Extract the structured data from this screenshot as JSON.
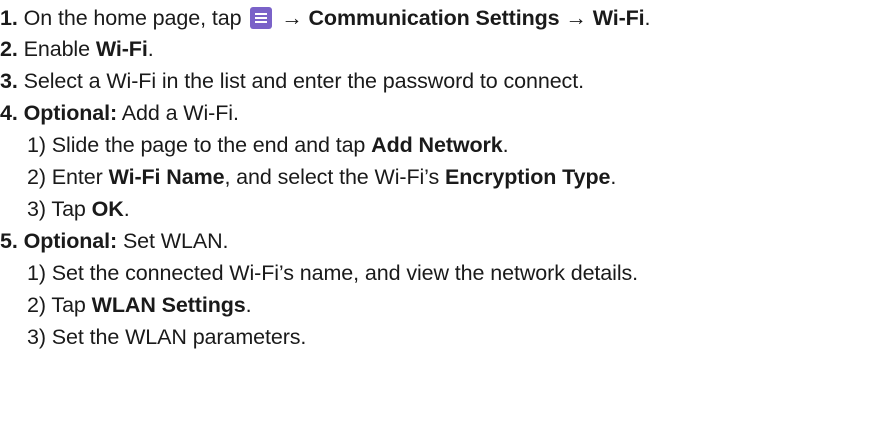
{
  "steps": [
    {
      "number": "1.",
      "text_before": "On the home page, tap",
      "icon": "menu-icon",
      "arrow1": "→",
      "target1": "Communication Settings",
      "arrow2": "→",
      "target2": "Wi-Fi",
      "end": "."
    },
    {
      "number": "2.",
      "text_before": "Enable",
      "target": "Wi-Fi",
      "end": "."
    },
    {
      "number": "3.",
      "text": "Select a Wi-Fi in the list and enter the password to connect."
    },
    {
      "number": "4.",
      "label": "Optional:",
      "text": "Add a Wi-Fi.",
      "substeps": [
        {
          "number": "1)",
          "text_before": "Slide the page to the end and tap",
          "target": "Add Network",
          "end": "."
        },
        {
          "number": "2)",
          "text_before": "Enter",
          "target1": "Wi-Fi Name",
          "middle": ", and select the Wi-Fi’s",
          "target2": "Encryption Type",
          "end": "."
        },
        {
          "number": "3)",
          "text_before": "Tap",
          "target": "OK",
          "end": "."
        }
      ]
    },
    {
      "number": "5.",
      "label": "Optional:",
      "text": "Set WLAN.",
      "substeps": [
        {
          "number": "1)",
          "text": "Set the connected Wi-Fi’s name, and view the network details."
        },
        {
          "number": "2)",
          "text_before": "Tap",
          "target": "WLAN Settings",
          "end": "."
        },
        {
          "number": "3)",
          "text": "Set the WLAN parameters."
        }
      ]
    }
  ]
}
